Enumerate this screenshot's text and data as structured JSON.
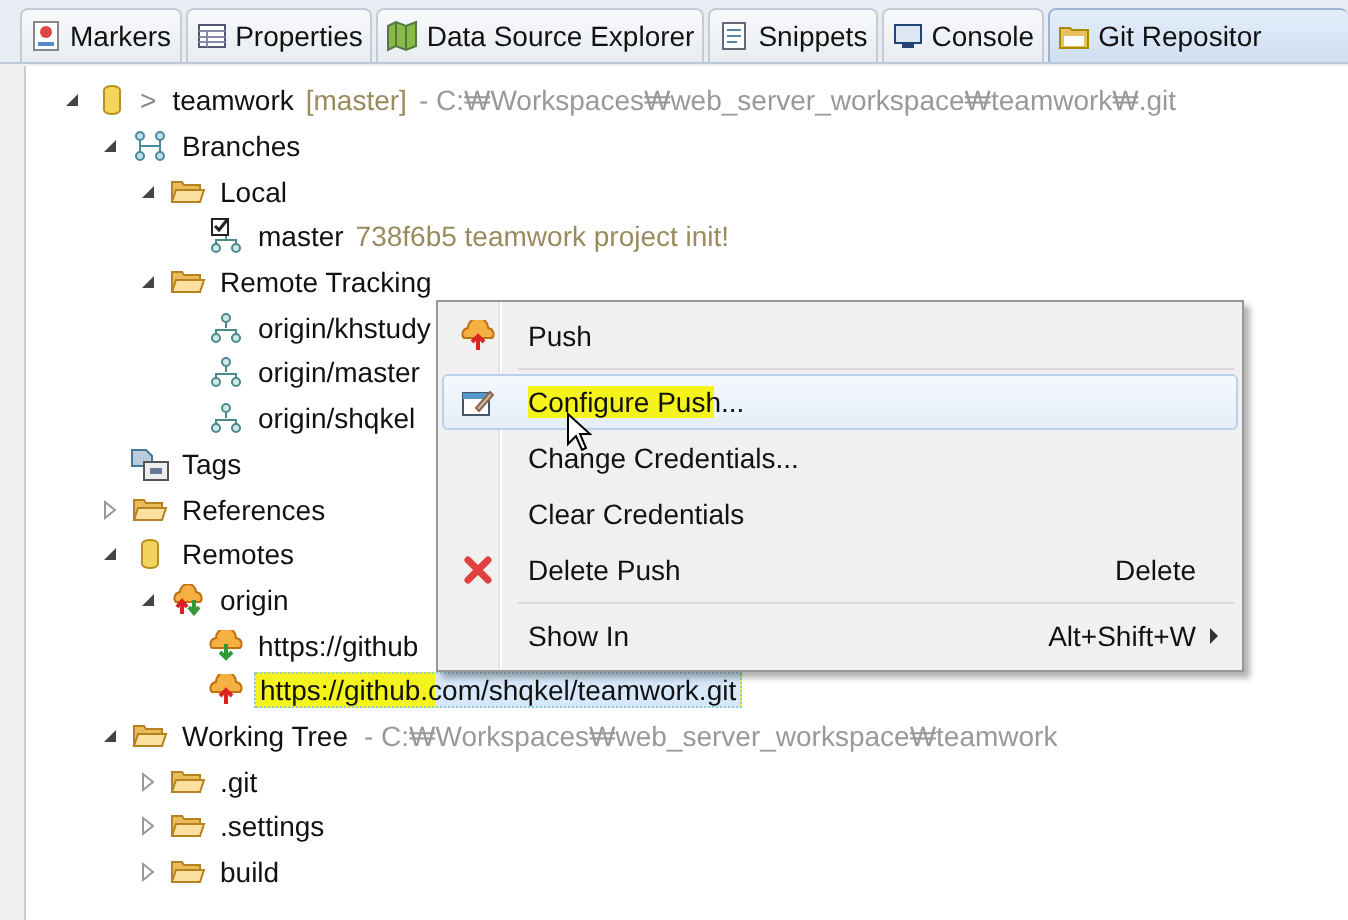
{
  "tabs": [
    {
      "label": "Markers",
      "kind": "markers",
      "selected": false
    },
    {
      "label": "Properties",
      "kind": "properties",
      "selected": false
    },
    {
      "label": "Data Source Explorer",
      "kind": "datasource",
      "selected": false
    },
    {
      "label": "Snippets",
      "kind": "snippets",
      "selected": false
    },
    {
      "label": "Console",
      "kind": "console",
      "selected": false
    },
    {
      "label": "Git Repositor",
      "kind": "git",
      "selected": true
    }
  ],
  "tree": [
    {
      "prefix": ">",
      "label": "teamwork",
      "ref": "[master]",
      "location": "- C:₩Workspaces₩web_server_workspace₩teamwork₩.git",
      "kind": "repository",
      "expanded": true,
      "selected": false,
      "children": [
        {
          "label": "Branches",
          "kind": "branches",
          "expanded": true,
          "selected": false,
          "children": [
            {
              "label": "Local",
              "kind": "folder",
              "expanded": true,
              "selected": false,
              "children": [
                {
                  "label": "master",
                  "ref": "738f6b5 teamwork project init!",
                  "kind": "checkout",
                  "selected": false
                }
              ]
            },
            {
              "label": "Remote Tracking",
              "kind": "folder",
              "expanded": true,
              "selected": false,
              "children": [
                {
                  "label": "origin/khstudy",
                  "kind": "branch",
                  "selected": false
                },
                {
                  "label": "origin/master",
                  "kind": "branch",
                  "selected": false
                },
                {
                  "label": "origin/shqkel",
                  "kind": "branch",
                  "selected": false
                }
              ]
            }
          ]
        },
        {
          "label": "Tags",
          "kind": "tags",
          "selected": false
        },
        {
          "label": "References",
          "kind": "folder",
          "expanded": false,
          "selected": false
        },
        {
          "label": "Remotes",
          "kind": "repository",
          "expanded": true,
          "selected": false,
          "children": [
            {
              "label": "origin",
              "kind": "remote",
              "expanded": true,
              "selected": false,
              "children": [
                {
                  "label": "https://github",
                  "kind": "fetch",
                  "selected": false
                },
                {
                  "label": "https://github.com/shqkel/teamwork.git",
                  "kind": "push",
                  "selected": true,
                  "marked": true
                }
              ]
            }
          ]
        },
        {
          "label": "Working Tree",
          "location": "- C:₩Workspaces₩web_server_workspace₩teamwork",
          "kind": "folder",
          "expanded": true,
          "selected": false,
          "children": [
            {
              "label": ".git",
              "kind": "folder",
              "expanded": false,
              "selected": false
            },
            {
              "label": ".settings",
              "kind": "folder",
              "expanded": false,
              "selected": false
            },
            {
              "label": "build",
              "kind": "folder",
              "expanded": false,
              "selected": false
            }
          ]
        }
      ]
    }
  ],
  "context_menu": [
    {
      "kind": "push",
      "label": "Push",
      "hover": false,
      "marked": false
    },
    {
      "kind": "separator"
    },
    {
      "kind": "edit",
      "label": "Configure Push...",
      "hover": true,
      "marked": true
    },
    {
      "kind": "plain",
      "label": "Change Credentials...",
      "hover": false,
      "marked": false
    },
    {
      "kind": "plain",
      "label": "Clear Credentials",
      "hover": false,
      "marked": false
    },
    {
      "kind": "delete",
      "label": "Delete Push",
      "shortcut": "Delete",
      "hover": false,
      "marked": false
    },
    {
      "kind": "separator"
    },
    {
      "kind": "submenu",
      "label": "Show In",
      "shortcut": "Alt+Shift+W",
      "hover": false,
      "marked": false
    }
  ]
}
